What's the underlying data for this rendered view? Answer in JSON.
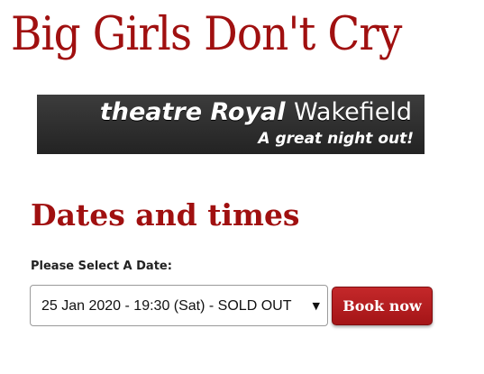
{
  "page": {
    "title": "Big Girls Don't Cry"
  },
  "logo": {
    "line1_part1": "theatre Royal ",
    "line1_part2": "Wakefield",
    "tagline": "A great night out!"
  },
  "booking": {
    "heading": "Dates and times",
    "date_label": "Please Select A Date:",
    "selected_date": "25 Jan 2020 - 19:30 (Sat) - SOLD OUT",
    "dropdown_icon": "triangle-down-icon",
    "book_button_label": "Book now"
  },
  "colors": {
    "brand_red": "#a01010",
    "button_red": "#b51d1f",
    "logo_background": "#2e2e2e"
  }
}
